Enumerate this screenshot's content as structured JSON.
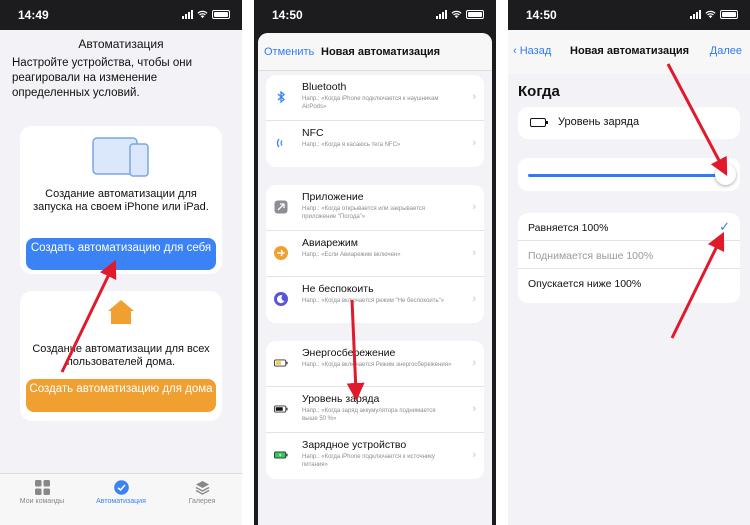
{
  "screens": [
    {
      "status_time": "14:49"
    },
    {
      "status_time": "14:50"
    },
    {
      "status_time": "14:50"
    }
  ],
  "screen1": {
    "title": "Автоматизация",
    "intro": "Настройте устройства, чтобы они реагировали на изменение определенных условий.",
    "personal_card": {
      "text": "Создание автоматизации для запуска на своем iPhone или iPad.",
      "button": "Создать автоматизацию для себя",
      "icon": "devices-icon"
    },
    "home_card": {
      "text": "Создание автоматизации для всех пользователей дома.",
      "button": "Создать автоматизацию для дома",
      "icon": "home-icon"
    },
    "tabs": [
      {
        "label": "Мои команды",
        "icon": "grid-icon"
      },
      {
        "label": "Автоматизация",
        "icon": "check-circle-icon",
        "active": true
      },
      {
        "label": "Галерея",
        "icon": "layers-icon"
      }
    ]
  },
  "screen2": {
    "cancel": "Отменить",
    "title": "Новая автоматизация",
    "groups": [
      [
        {
          "title": "Bluetooth",
          "subtitle": "Напр.: «Когда iPhone подключается к наушникам AirPods»",
          "icon": "bluetooth-icon"
        },
        {
          "title": "NFC",
          "subtitle": "Напр.: «Когда я касаюсь тега NFC»",
          "icon": "nfc-icon"
        }
      ],
      [
        {
          "title": "Приложение",
          "subtitle": "Напр.: «Когда открывается или закрывается приложение \"Погода\"»",
          "icon": "app-icon"
        },
        {
          "title": "Авиарежим",
          "subtitle": "Напр.: «Если Авиарежим включен»",
          "icon": "airplane-icon"
        },
        {
          "title": "Не беспокоить",
          "subtitle": "Напр.: «Когда включается режим \"Не беспокоить\"»",
          "icon": "moon-icon"
        }
      ],
      [
        {
          "title": "Энергосбережение",
          "subtitle": "Напр.: «Когда включается Режим энергосбережения»",
          "icon": "low-power-icon"
        },
        {
          "title": "Уровень заряда",
          "subtitle": "Напр.: «Когда заряд аккумулятора поднимается выше 50 %»",
          "icon": "battery-icon"
        },
        {
          "title": "Зарядное устройство",
          "subtitle": "Напр.: «Когда iPhone подключается к источнику питания»",
          "icon": "charger-icon"
        }
      ]
    ]
  },
  "screen3": {
    "back": "Назад",
    "title": "Новая автоматизация",
    "next": "Далее",
    "heading": "Когда",
    "level_label": "Уровень заряда",
    "slider_value_percent": 100,
    "options": [
      {
        "label": "Равняется 100%",
        "selected": true
      },
      {
        "label": "Поднимается выше 100%",
        "disabled": true
      },
      {
        "label": "Опускается ниже 100%"
      }
    ]
  },
  "colors": {
    "accent": "#2f7bf6",
    "orange": "#f0a030",
    "arrow": "#e0192b"
  }
}
